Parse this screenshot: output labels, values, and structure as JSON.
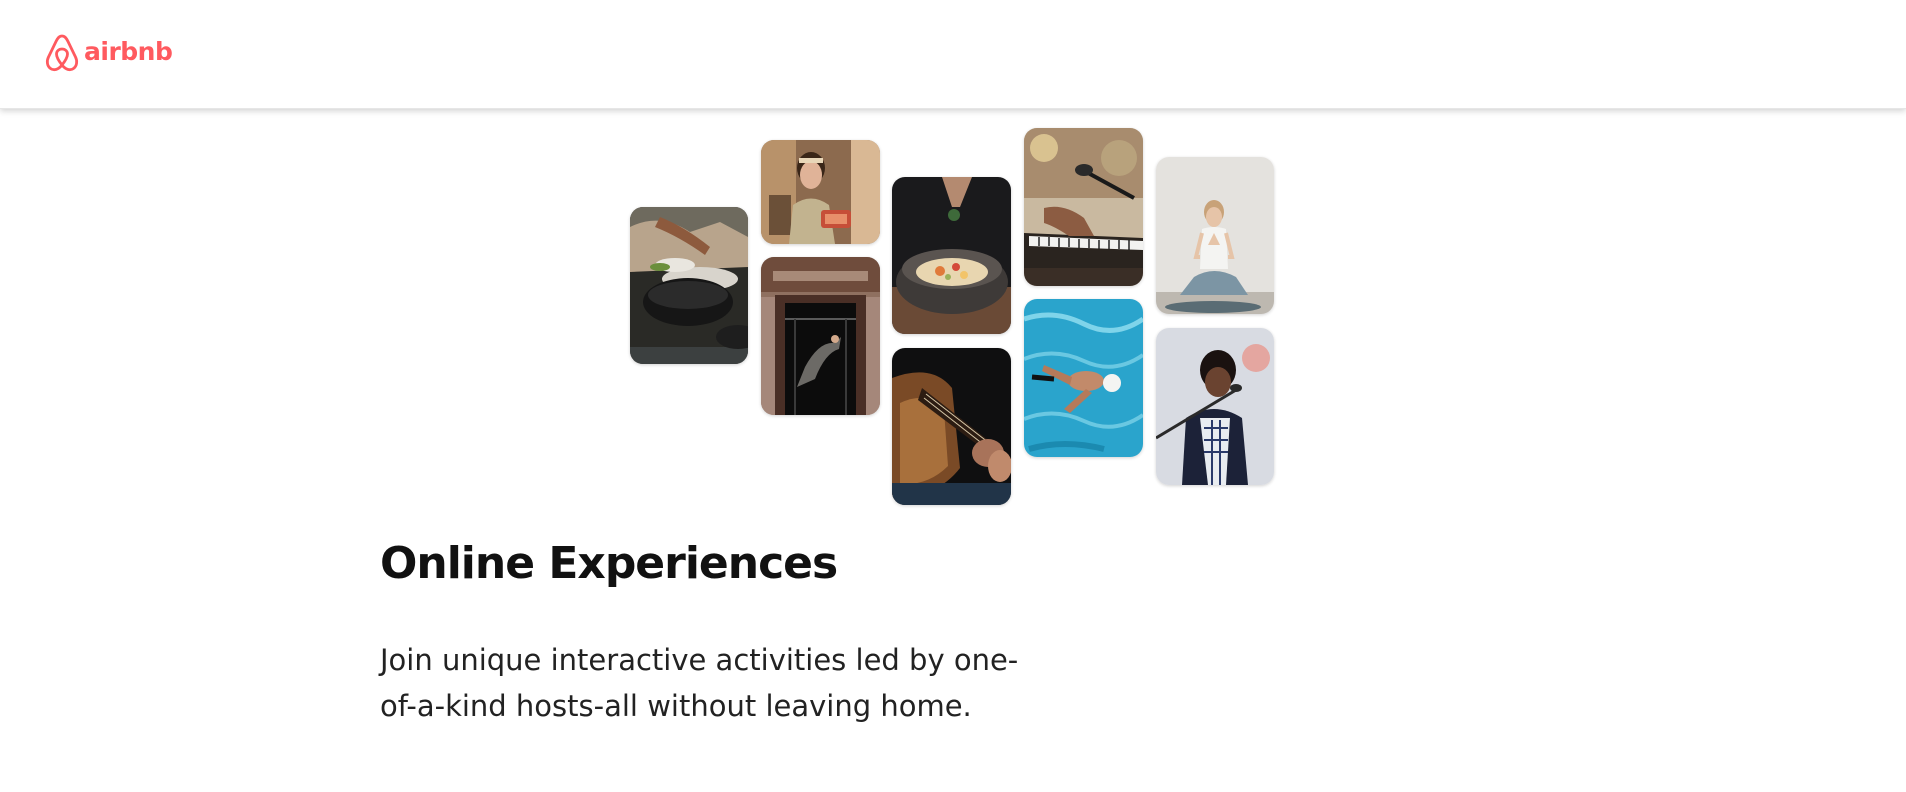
{
  "header": {
    "logo_text": "airbnb",
    "logo_icon": "airbnb-belo-icon",
    "brand_color": "#ff5a5f"
  },
  "collage": {
    "photos": [
      {
        "name": "photo-cooking-pans",
        "subject": "cooking"
      },
      {
        "name": "photo-woman-kitchen",
        "subject": "woman in kitchen"
      },
      {
        "name": "photo-dancer-doorway",
        "subject": "dancer in doorway"
      },
      {
        "name": "photo-food-bowl",
        "subject": "food bowl"
      },
      {
        "name": "photo-guitar",
        "subject": "guitar"
      },
      {
        "name": "photo-piano-microphone",
        "subject": "piano and microphone"
      },
      {
        "name": "photo-swimmer",
        "subject": "swimmer"
      },
      {
        "name": "photo-yoga",
        "subject": "yoga"
      },
      {
        "name": "photo-singer",
        "subject": "singer"
      }
    ]
  },
  "main": {
    "title": "Online Experiences",
    "description": "Join unique interactive activities led by one-of-a-kind hosts-all without leaving home."
  }
}
